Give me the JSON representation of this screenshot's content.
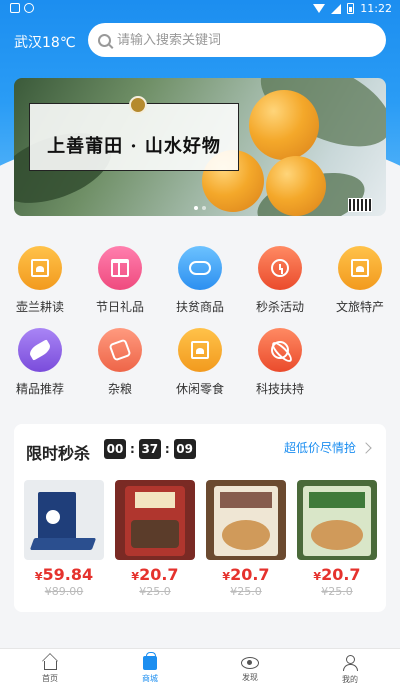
{
  "status_bar": {
    "time": "11:22"
  },
  "header": {
    "city_weather": "武汉18℃",
    "search_placeholder": "请输入搜索关键词"
  },
  "banner": {
    "text": "上善莆田 · 山水好物"
  },
  "categories": [
    {
      "label": "壶兰耕读",
      "icon": "book-icon",
      "color": "#f5a623"
    },
    {
      "label": "节日礼品",
      "icon": "gift-icon",
      "color": "#f45b8e"
    },
    {
      "label": "扶贫商品",
      "icon": "handshake-icon",
      "color": "#3aa2f2"
    },
    {
      "label": "秒杀活动",
      "icon": "alarm-clock-icon",
      "color": "#f2603f"
    },
    {
      "label": "文旅特产",
      "icon": "box-icon",
      "color": "#f5a623"
    },
    {
      "label": "精品推荐",
      "icon": "leaf-icon",
      "color": "#8a5ee0"
    },
    {
      "label": "杂粮",
      "icon": "grain-bag-icon",
      "color": "#f4785e"
    },
    {
      "label": "休闲零食",
      "icon": "snack-icon",
      "color": "#f5a623"
    },
    {
      "label": "科技扶持",
      "icon": "atom-icon",
      "color": "#f2603f"
    }
  ],
  "flash_sale": {
    "title": "限时秒杀",
    "timer": {
      "hours": "00",
      "minutes": "37",
      "seconds": "09"
    },
    "more_label": "超低价尽情抢",
    "products": [
      {
        "price_symbol": "¥",
        "price": "59.84",
        "original": "¥89.00"
      },
      {
        "price_symbol": "¥",
        "price": "20.7",
        "original": "¥25.0"
      },
      {
        "price_symbol": "¥",
        "price": "20.7",
        "original": "¥25.0"
      },
      {
        "price_symbol": "¥",
        "price": "20.7",
        "original": "¥25.0"
      }
    ]
  },
  "tabbar": [
    {
      "label": "首页",
      "icon": "home-icon"
    },
    {
      "label": "商城",
      "icon": "shopping-bag-icon",
      "active": true
    },
    {
      "label": "发现",
      "icon": "eye-icon"
    },
    {
      "label": "我的",
      "icon": "user-icon"
    }
  ],
  "colors": {
    "primary": "#1c8ef0",
    "price": "#e5322d"
  }
}
